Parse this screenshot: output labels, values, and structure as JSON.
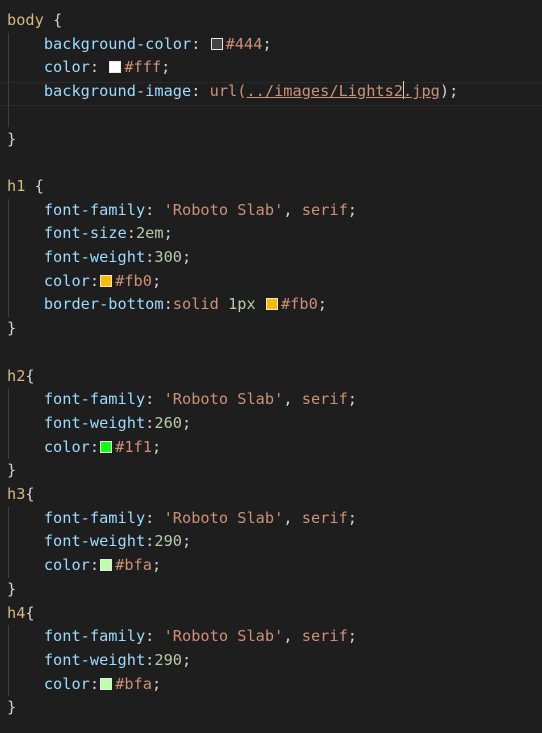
{
  "theme": {
    "background": "#1e1e1e",
    "selector_color": "#d7ba7d",
    "property_color": "#9cdcfe",
    "string_color": "#ce9178",
    "number_color": "#b5cea8"
  },
  "lines": [
    [
      {
        "t": "body",
        "c": "selector"
      },
      {
        "t": " {",
        "c": "punct"
      }
    ],
    [
      {
        "t": "    "
      },
      {
        "t": "background-color",
        "c": "prop"
      },
      {
        "t": ": ",
        "c": "punct"
      },
      {
        "sw": "#444444"
      },
      {
        "t": "#444",
        "c": "value"
      },
      {
        "t": ";",
        "c": "punct"
      }
    ],
    [
      {
        "t": "    "
      },
      {
        "t": "color",
        "c": "prop"
      },
      {
        "t": ": ",
        "c": "punct"
      },
      {
        "sw": "#ffffff"
      },
      {
        "t": "#fff",
        "c": "value"
      },
      {
        "t": ";",
        "c": "punct"
      }
    ],
    [
      {
        "t": "    "
      },
      {
        "t": "background-image",
        "c": "prop"
      },
      {
        "t": ": ",
        "c": "punct"
      },
      {
        "t": "url(",
        "c": "value"
      },
      {
        "t": "../images/Lights2",
        "c": "value link"
      },
      {
        "cursor": true
      },
      {
        "t": ".jpg",
        "c": "value link"
      },
      {
        "t": ");",
        "c": "punct"
      }
    ],
    [
      {
        "t": ""
      }
    ],
    [
      {
        "t": "}",
        "c": "punct"
      }
    ],
    [
      {
        "t": ""
      }
    ],
    [
      {
        "t": "h1",
        "c": "selector"
      },
      {
        "t": " {",
        "c": "punct"
      }
    ],
    [
      {
        "t": "    "
      },
      {
        "t": "font-family",
        "c": "prop"
      },
      {
        "t": ": ",
        "c": "punct"
      },
      {
        "t": "'Roboto Slab'",
        "c": "value"
      },
      {
        "t": ", ",
        "c": "punct"
      },
      {
        "t": "serif",
        "c": "value"
      },
      {
        "t": ";",
        "c": "punct"
      }
    ],
    [
      {
        "t": "    "
      },
      {
        "t": "font-size",
        "c": "prop"
      },
      {
        "t": ":",
        "c": "punct"
      },
      {
        "t": "2em",
        "c": "num"
      },
      {
        "t": ";",
        "c": "punct"
      }
    ],
    [
      {
        "t": "    "
      },
      {
        "t": "font-weight",
        "c": "prop"
      },
      {
        "t": ":",
        "c": "punct"
      },
      {
        "t": "300",
        "c": "num"
      },
      {
        "t": ";",
        "c": "punct"
      }
    ],
    [
      {
        "t": "    "
      },
      {
        "t": "color",
        "c": "prop"
      },
      {
        "t": ":",
        "c": "punct"
      },
      {
        "sw": "#ffbb00"
      },
      {
        "t": "#fb0",
        "c": "value"
      },
      {
        "t": ";",
        "c": "punct"
      }
    ],
    [
      {
        "t": "    "
      },
      {
        "t": "border-bottom",
        "c": "prop"
      },
      {
        "t": ":",
        "c": "punct"
      },
      {
        "t": "solid",
        "c": "value"
      },
      {
        "t": " ",
        "c": "punct"
      },
      {
        "t": "1px",
        "c": "num"
      },
      {
        "t": " ",
        "c": "punct"
      },
      {
        "sw": "#ffbb00"
      },
      {
        "t": "#fb0",
        "c": "value"
      },
      {
        "t": ";",
        "c": "punct"
      }
    ],
    [
      {
        "t": "}",
        "c": "punct"
      }
    ],
    [
      {
        "t": ""
      }
    ],
    [
      {
        "t": "h2",
        "c": "selector"
      },
      {
        "t": "{",
        "c": "punct"
      }
    ],
    [
      {
        "t": "    "
      },
      {
        "t": "font-family",
        "c": "prop"
      },
      {
        "t": ": ",
        "c": "punct"
      },
      {
        "t": "'Roboto Slab'",
        "c": "value"
      },
      {
        "t": ", ",
        "c": "punct"
      },
      {
        "t": "serif",
        "c": "value"
      },
      {
        "t": ";",
        "c": "punct"
      }
    ],
    [
      {
        "t": "    "
      },
      {
        "t": "font-weight",
        "c": "prop"
      },
      {
        "t": ":",
        "c": "punct"
      },
      {
        "t": "260",
        "c": "num"
      },
      {
        "t": ";",
        "c": "punct"
      }
    ],
    [
      {
        "t": "    "
      },
      {
        "t": "color",
        "c": "prop"
      },
      {
        "t": ":",
        "c": "punct"
      },
      {
        "sw": "#11ff11"
      },
      {
        "t": "#1f1",
        "c": "value"
      },
      {
        "t": ";",
        "c": "punct"
      }
    ],
    [
      {
        "t": "}",
        "c": "punct"
      }
    ],
    [
      {
        "t": "h3",
        "c": "selector"
      },
      {
        "t": "{",
        "c": "punct"
      }
    ],
    [
      {
        "t": "    "
      },
      {
        "t": "font-family",
        "c": "prop"
      },
      {
        "t": ": ",
        "c": "punct"
      },
      {
        "t": "'Roboto Slab'",
        "c": "value"
      },
      {
        "t": ", ",
        "c": "punct"
      },
      {
        "t": "serif",
        "c": "value"
      },
      {
        "t": ";",
        "c": "punct"
      }
    ],
    [
      {
        "t": "    "
      },
      {
        "t": "font-weight",
        "c": "prop"
      },
      {
        "t": ":",
        "c": "punct"
      },
      {
        "t": "290",
        "c": "num"
      },
      {
        "t": ";",
        "c": "punct"
      }
    ],
    [
      {
        "t": "    "
      },
      {
        "t": "color",
        "c": "prop"
      },
      {
        "t": ":",
        "c": "punct"
      },
      {
        "sw": "#bbffaa"
      },
      {
        "t": "#bfa",
        "c": "value"
      },
      {
        "t": ";",
        "c": "punct"
      }
    ],
    [
      {
        "t": "}",
        "c": "punct"
      }
    ],
    [
      {
        "t": "h4",
        "c": "selector"
      },
      {
        "t": "{",
        "c": "punct"
      }
    ],
    [
      {
        "t": "    "
      },
      {
        "t": "font-family",
        "c": "prop"
      },
      {
        "t": ": ",
        "c": "punct"
      },
      {
        "t": "'Roboto Slab'",
        "c": "value"
      },
      {
        "t": ", ",
        "c": "punct"
      },
      {
        "t": "serif",
        "c": "value"
      },
      {
        "t": ";",
        "c": "punct"
      }
    ],
    [
      {
        "t": "    "
      },
      {
        "t": "font-weight",
        "c": "prop"
      },
      {
        "t": ":",
        "c": "punct"
      },
      {
        "t": "290",
        "c": "num"
      },
      {
        "t": ";",
        "c": "punct"
      }
    ],
    [
      {
        "t": "    "
      },
      {
        "t": "color",
        "c": "prop"
      },
      {
        "t": ":",
        "c": "punct"
      },
      {
        "sw": "#bbffaa"
      },
      {
        "t": "#bfa",
        "c": "value"
      },
      {
        "t": ";",
        "c": "punct"
      }
    ],
    [
      {
        "t": "}",
        "c": "punct"
      }
    ]
  ]
}
